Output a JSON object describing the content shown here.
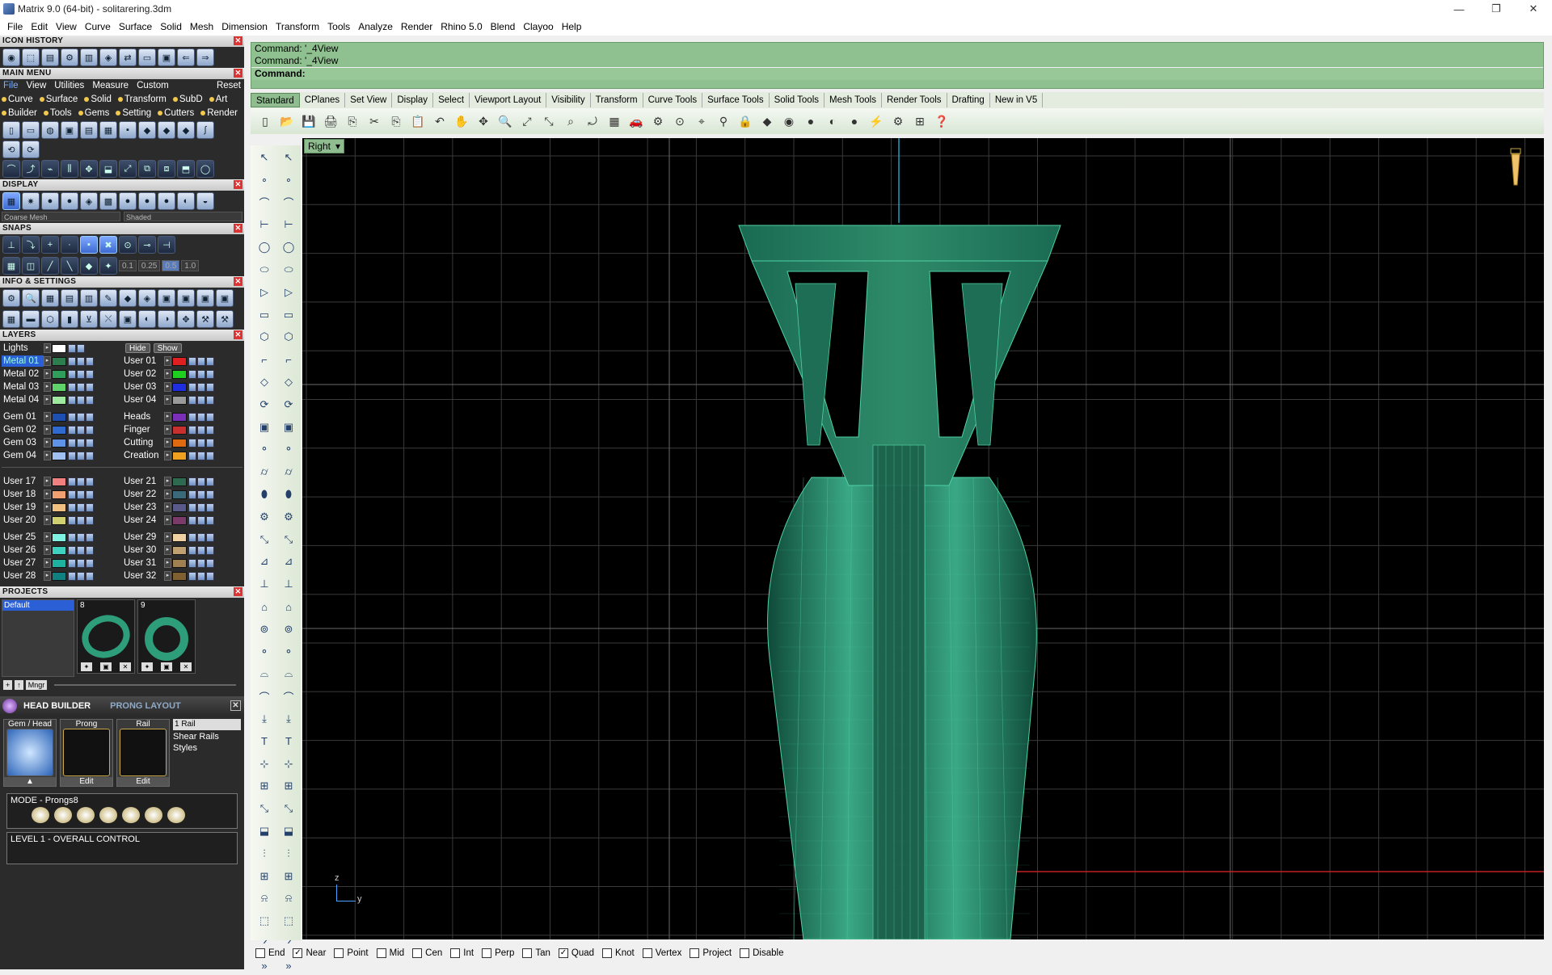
{
  "window": {
    "title": "Matrix 9.0 (64-bit) - solitarering.3dm",
    "minimize": "—",
    "maximize": "❐",
    "close": "✕"
  },
  "menu": [
    "File",
    "Edit",
    "View",
    "Curve",
    "Surface",
    "Solid",
    "Mesh",
    "Dimension",
    "Transform",
    "Tools",
    "Analyze",
    "Render",
    "Rhino 5.0",
    "Blend",
    "Clayoo",
    "Help"
  ],
  "panels": {
    "icon_history": "ICON HISTORY",
    "main_menu": "MAIN MENU",
    "main_menu_tabs": [
      "File",
      "View",
      "Utilities",
      "Measure",
      "Custom",
      "Reset"
    ],
    "main_menu_row1": [
      "Curve",
      "Surface",
      "Solid",
      "Transform",
      "SubD",
      "Art"
    ],
    "main_menu_row2": [
      "Builder",
      "Tools",
      "Gems",
      "Setting",
      "Cutters",
      "Render"
    ],
    "display": "DISPLAY",
    "display_mesh": "Coarse Mesh",
    "display_mode": "Shaded",
    "snaps": "SNAPS",
    "snap_values": [
      "0.1",
      "0.25",
      "0.5",
      "1.0"
    ],
    "info_settings": "INFO & SETTINGS",
    "layers": "LAYERS",
    "projects": "PROJECTS",
    "project_default": "Default",
    "project_mngr": "Mngr",
    "thumb_nums": [
      "8",
      "9"
    ]
  },
  "layers": {
    "lights": "Lights",
    "hide": "Hide",
    "show": "Show",
    "rows": [
      [
        {
          "n": "Metal 01",
          "c": "#2e7d4f",
          "sel": true
        },
        {
          "n": "User 01",
          "c": "#e02020"
        }
      ],
      [
        {
          "n": "Metal 02",
          "c": "#2e9e5a"
        },
        {
          "n": "User 02",
          "c": "#20d020"
        }
      ],
      [
        {
          "n": "Metal 03",
          "c": "#5fd36a"
        },
        {
          "n": "User 03",
          "c": "#1f2fe0"
        }
      ],
      [
        {
          "n": "Metal 04",
          "c": "#9fe8a0"
        },
        {
          "n": "User 04",
          "c": "#9a9a9a"
        }
      ],
      [
        {
          "n": "Gem 01",
          "c": "#1d4fb0"
        },
        {
          "n": "Heads",
          "c": "#7a2fb8"
        }
      ],
      [
        {
          "n": "Gem 02",
          "c": "#2f6ad0"
        },
        {
          "n": "Finger",
          "c": "#c83030"
        }
      ],
      [
        {
          "n": "Gem 03",
          "c": "#5f93e8"
        },
        {
          "n": "Cutting",
          "c": "#e06a10"
        }
      ],
      [
        {
          "n": "Gem 04",
          "c": "#9fc0f0"
        },
        {
          "n": "Creation",
          "c": "#f0a020"
        }
      ],
      [
        {
          "n": "User 17",
          "c": "#f08080"
        },
        {
          "n": "User 21",
          "c": "#2e6a50"
        }
      ],
      [
        {
          "n": "User 18",
          "c": "#f0a070"
        },
        {
          "n": "User 22",
          "c": "#3a6a7a"
        }
      ],
      [
        {
          "n": "User 19",
          "c": "#f0c080"
        },
        {
          "n": "User 23",
          "c": "#5a5a8a"
        }
      ],
      [
        {
          "n": "User 20",
          "c": "#d0d070"
        },
        {
          "n": "User 24",
          "c": "#7a3a6a"
        }
      ],
      [
        {
          "n": "User 25",
          "c": "#80f0e0"
        },
        {
          "n": "User 29",
          "c": "#f0d0a0"
        }
      ],
      [
        {
          "n": "User 26",
          "c": "#40d0c0"
        },
        {
          "n": "User 30",
          "c": "#c0a070"
        }
      ],
      [
        {
          "n": "User 27",
          "c": "#20b0a0"
        },
        {
          "n": "User 31",
          "c": "#a08050"
        }
      ],
      [
        {
          "n": "User 28",
          "c": "#108080"
        },
        {
          "n": "User 32",
          "c": "#806030"
        }
      ]
    ]
  },
  "head_builder": {
    "title": "HEAD BUILDER",
    "tab2": "PRONG LAYOUT",
    "cells": [
      {
        "cap": "Gem / Head",
        "edit": "▲"
      },
      {
        "cap": "Prong",
        "edit": "Edit"
      },
      {
        "cap": "Rail",
        "edit": "Edit"
      }
    ],
    "rail_select": "1 Rail",
    "shear_rails": "Shear Rails",
    "styles": "Styles",
    "mode": "MODE - Prongs8",
    "level": "LEVEL 1 - OVERALL CONTROL"
  },
  "command": {
    "line1": "Command: '_4View",
    "line2": "Command: '_4View",
    "prompt": "Command:"
  },
  "tabs": [
    "Standard",
    "CPlanes",
    "Set View",
    "Display",
    "Select",
    "Viewport Layout",
    "Visibility",
    "Transform",
    "Curve Tools",
    "Surface Tools",
    "Solid Tools",
    "Mesh Tools",
    "Render Tools",
    "Drafting",
    "New in V5"
  ],
  "viewport": {
    "name": "Right",
    "axis_z": "z",
    "axis_y": "y",
    "bg": "#000000",
    "model_color": "#2e8b6a"
  },
  "osnaps": [
    {
      "label": "End",
      "checked": false
    },
    {
      "label": "Near",
      "checked": true
    },
    {
      "label": "Point",
      "checked": false
    },
    {
      "label": "Mid",
      "checked": false
    },
    {
      "label": "Cen",
      "checked": false
    },
    {
      "label": "Int",
      "checked": false
    },
    {
      "label": "Perp",
      "checked": false
    },
    {
      "label": "Tan",
      "checked": false
    },
    {
      "label": "Quad",
      "checked": true
    },
    {
      "label": "Knot",
      "checked": false
    },
    {
      "label": "Vertex",
      "checked": false
    },
    {
      "label": "Project",
      "checked": false
    },
    {
      "label": "Disable",
      "checked": false
    }
  ]
}
